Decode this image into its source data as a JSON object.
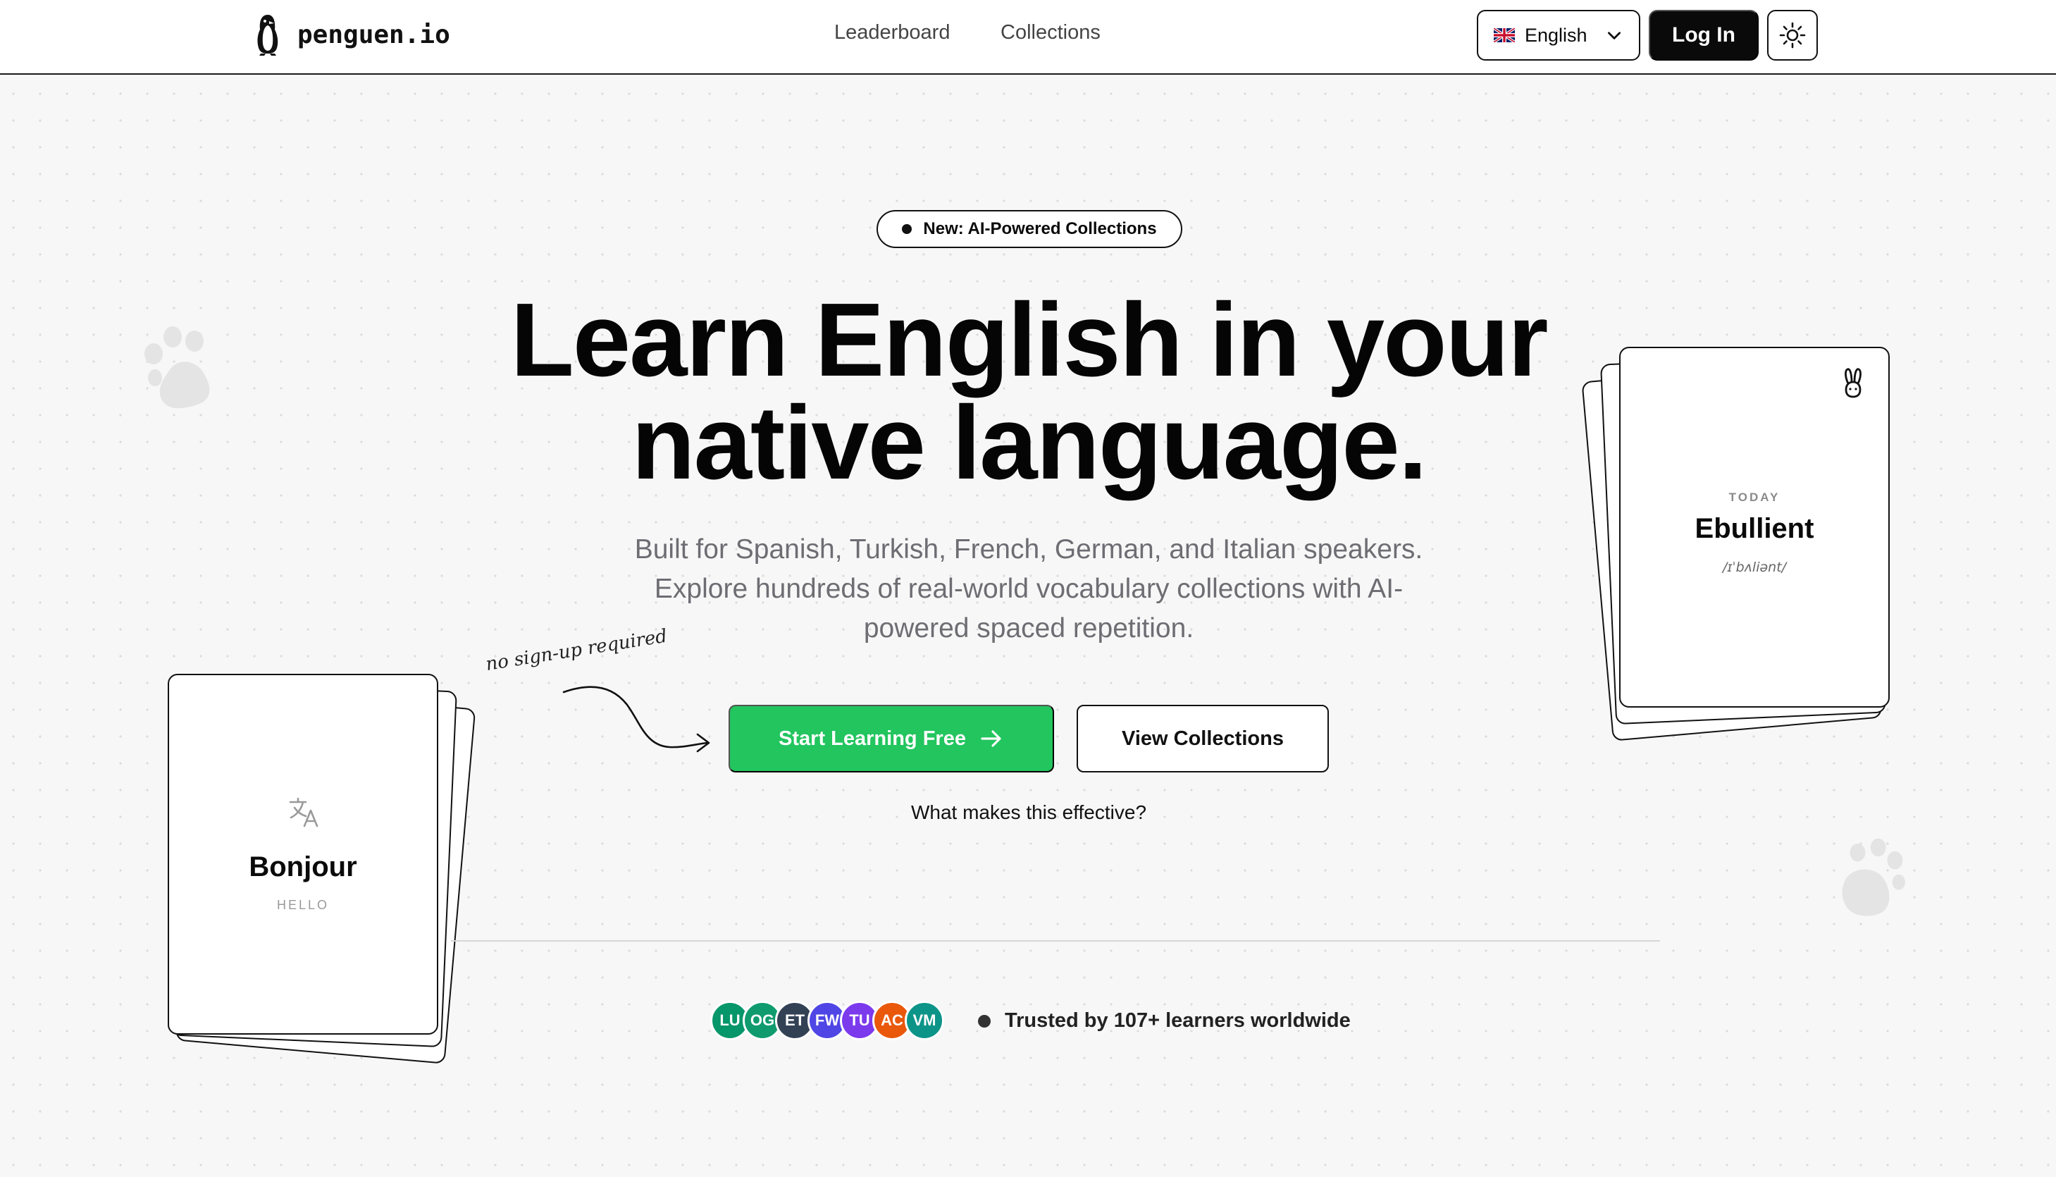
{
  "header": {
    "logo_text": "penguen.io",
    "nav": [
      {
        "label": "Leaderboard"
      },
      {
        "label": "Collections"
      }
    ],
    "language": {
      "selected": "English",
      "flag": "uk-flag-icon"
    },
    "login_label": "Log In",
    "theme_toggle_icon": "sun-icon"
  },
  "hero": {
    "badge": "New: AI-Powered Collections",
    "headline_line1": "Learn English in your",
    "headline_line2": "native language.",
    "subtitle_line1": "Built for Spanish, Turkish, French, German, and Italian speakers.",
    "subtitle_line2": "Explore hundreds of real-world vocabulary collections with AI-",
    "subtitle_line3": "powered spaced repetition.",
    "handnote": "no sign-up required",
    "cta_primary": "Start Learning Free",
    "cta_secondary": "View Collections",
    "effective_link": "What makes this effective?"
  },
  "cards": {
    "left": {
      "word": "Bonjour",
      "translation": "HELLO",
      "icon": "translate-icon"
    },
    "right": {
      "label": "TODAY",
      "word": "Ebullient",
      "ipa": "/ɪˈbʌliənt/",
      "icon": "bunny-icon"
    }
  },
  "social_proof": {
    "avatars": [
      {
        "initials": "LU",
        "color": "#059669"
      },
      {
        "initials": "OG",
        "color": "#0f9b6e"
      },
      {
        "initials": "ET",
        "color": "#334155"
      },
      {
        "initials": "FW",
        "color": "#4f46e5"
      },
      {
        "initials": "TU",
        "color": "#7c3aed"
      },
      {
        "initials": "AC",
        "color": "#ea580c"
      },
      {
        "initials": "VM",
        "color": "#0d9488"
      }
    ],
    "text": "Trusted by 107+ learners worldwide"
  },
  "colors": {
    "accent": "#22c55e",
    "ink": "#0a0a0a",
    "muted": "#6d6d73"
  }
}
